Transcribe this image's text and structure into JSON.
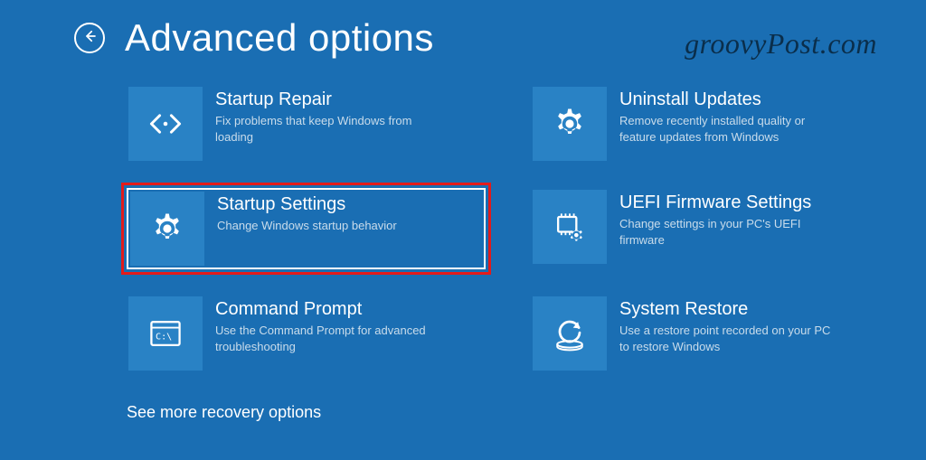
{
  "header": {
    "title": "Advanced options"
  },
  "watermark": "groovyPost.com",
  "tiles": [
    {
      "title": "Startup Repair",
      "desc": "Fix problems that keep Windows from loading"
    },
    {
      "title": "Uninstall Updates",
      "desc": "Remove recently installed quality or feature updates from Windows"
    },
    {
      "title": "Startup Settings",
      "desc": "Change Windows startup behavior"
    },
    {
      "title": "UEFI Firmware Settings",
      "desc": "Change settings in your PC's UEFI firmware"
    },
    {
      "title": "Command Prompt",
      "desc": "Use the Command Prompt for advanced troubleshooting"
    },
    {
      "title": "System Restore",
      "desc": "Use a restore point recorded on your PC to restore Windows"
    }
  ],
  "more_link": "See more recovery options"
}
